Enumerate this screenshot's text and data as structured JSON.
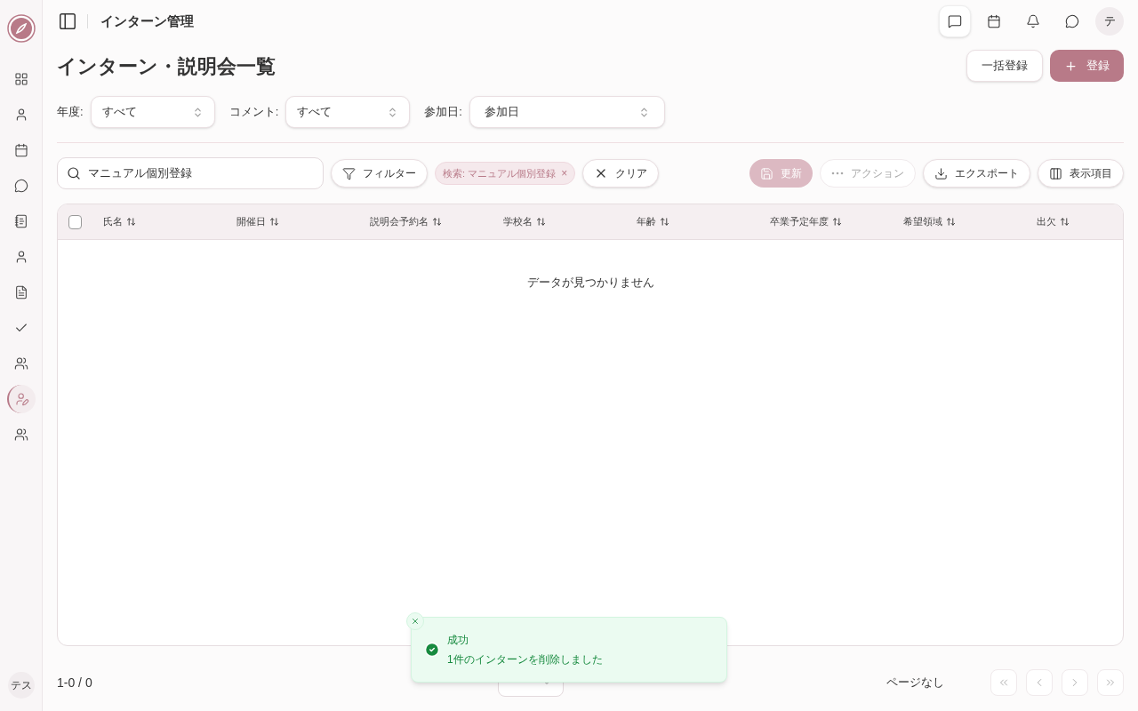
{
  "sidebar": {
    "items": [
      {
        "selected": false
      },
      {
        "selected": false
      },
      {
        "selected": false
      },
      {
        "selected": false
      },
      {
        "selected": false
      },
      {
        "selected": false
      },
      {
        "selected": false
      },
      {
        "selected": false
      },
      {
        "selected": false
      },
      {
        "selected": true
      },
      {
        "selected": false
      }
    ],
    "user_avatar": "テス"
  },
  "header": {
    "title": "インターン管理",
    "avatar": "テ"
  },
  "page_title": "インターン・説明会一覧",
  "actions": [
    {
      "kind": "outline",
      "label": "一括登録"
    },
    {
      "kind": "primary",
      "label": "登録"
    }
  ],
  "filters": [
    {
      "label": "年度:",
      "value": "すべて"
    },
    {
      "label": "コメント:",
      "value": "すべて"
    },
    {
      "label": "参加日:",
      "value": "参加日"
    }
  ],
  "search": {
    "value": "マニュアル個別登録"
  },
  "filter_button": "フィルター",
  "chip": {
    "label": "検索: マニュアル個別登録",
    "remove": "×"
  },
  "clear_button": "クリア",
  "toolbar": [
    {
      "kind": "save",
      "label": "更新",
      "disabled": true
    },
    {
      "kind": "more",
      "label": "アクション",
      "disabled": true
    },
    {
      "kind": "export",
      "label": "エクスポート",
      "disabled": false
    },
    {
      "kind": "columns",
      "label": "表示項目",
      "disabled": false
    }
  ],
  "table": {
    "select_all": {
      "checked": false
    },
    "columns": [
      "氏名",
      "開催日",
      "説明会予約名",
      "学校名",
      "年齢",
      "卒業予定年度",
      "希望領域",
      "出欠"
    ],
    "empty": "データが見つかりません"
  },
  "footer": {
    "range": "1-0 / 0",
    "pages": "ページなし",
    "nav": [
      {
        "kind": "first",
        "disabled": true
      },
      {
        "kind": "prev",
        "disabled": true
      },
      {
        "kind": "next",
        "disabled": true
      },
      {
        "kind": "last",
        "disabled": true
      }
    ]
  },
  "toast": {
    "title": "成功",
    "message": "1件のインターンを削除しました"
  }
}
